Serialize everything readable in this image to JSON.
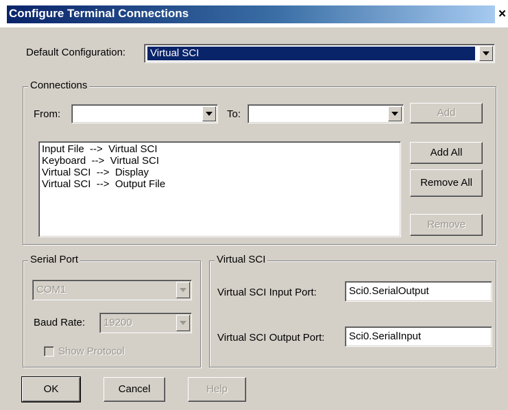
{
  "window": {
    "title": "Configure Terminal Connections",
    "close_glyph": "×"
  },
  "default_config": {
    "label": "Default Configuration:",
    "value": "Virtual SCI"
  },
  "connections": {
    "legend": "Connections",
    "from_label": "From:",
    "from_value": "",
    "to_label": "To:",
    "to_value": "",
    "add_label": "Add",
    "add_all_label": "Add All",
    "remove_all_label": "Remove All",
    "remove_label": "Remove",
    "items": [
      "Input File  -->  Virtual SCI",
      "Keyboard  -->  Virtual SCI",
      "Virtual SCI  -->  Display",
      "Virtual SCI  -->  Output File"
    ]
  },
  "serial_port": {
    "legend": "Serial Port",
    "port_value": "COM1",
    "baud_label": "Baud Rate:",
    "baud_value": "19200",
    "show_protocol_label": "Show Protocol"
  },
  "virtual_sci": {
    "legend": "Virtual SCI",
    "input_label": "Virtual SCI Input Port:",
    "input_value": "Sci0.SerialOutput",
    "output_label": "Virtual SCI Output Port:",
    "output_value": "Sci0.SerialInput"
  },
  "buttons": {
    "ok": "OK",
    "cancel": "Cancel",
    "help": "Help"
  },
  "colors": {
    "title_start": "#0a246a",
    "title_end": "#a6caf0",
    "selection": "#0a246a",
    "face": "#d4d0c8"
  }
}
